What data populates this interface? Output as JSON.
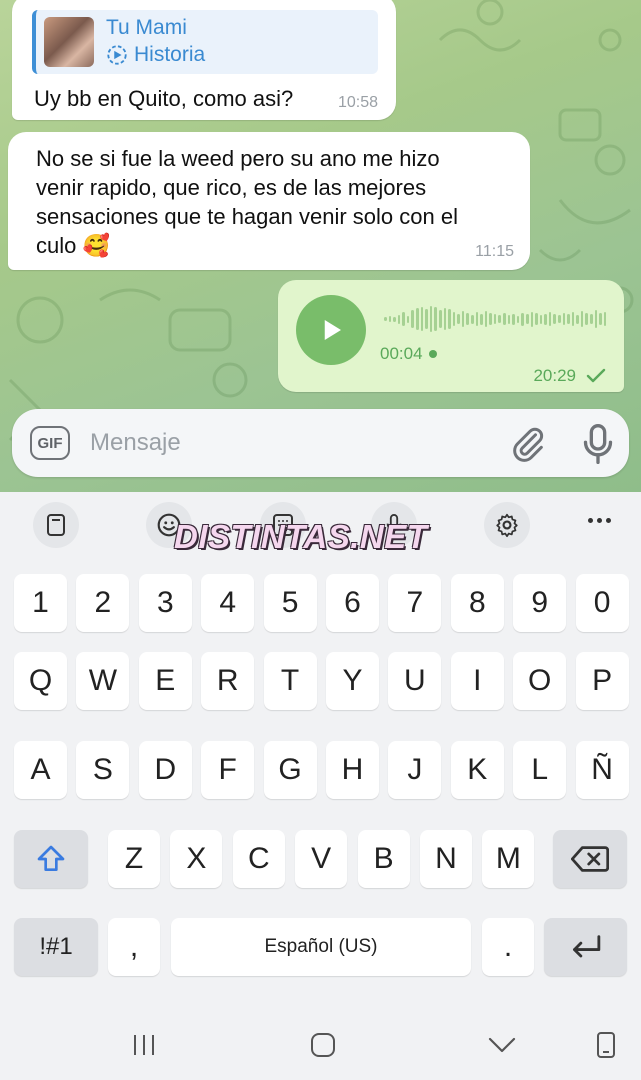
{
  "chat": {
    "messages": [
      {
        "direction": "incoming",
        "reply_to": {
          "name": "Tu Mami",
          "label": "Historia"
        },
        "text": "Uy bb en Quito, como asi?",
        "time": "10:58"
      },
      {
        "direction": "incoming",
        "lines": [
          "No se si fue la weed pero su ano me hizo",
          "venir rapido, que rico, es de las mejores",
          "sensaciones que te hagan venir solo con el",
          "culo 🥰"
        ],
        "time": "11:15"
      },
      {
        "direction": "outgoing",
        "type": "voice",
        "duration": "00:04",
        "time": "20:29",
        "status_icon": "check-icon"
      }
    ]
  },
  "composer": {
    "gif_label": "GIF",
    "placeholder": "Mensaje",
    "attach_icon": "paperclip-icon",
    "mic_icon": "microphone-icon"
  },
  "keyboard": {
    "toolbar_icons": [
      "clipboard-icon",
      "emoji-icon",
      "keyboard-icon",
      "voice-input-icon",
      "settings-icon",
      "more-icon"
    ],
    "watermark": "DISTINTAS.NET",
    "row_numbers": [
      "1",
      "2",
      "3",
      "4",
      "5",
      "6",
      "7",
      "8",
      "9",
      "0"
    ],
    "row_1": [
      "Q",
      "W",
      "E",
      "R",
      "T",
      "Y",
      "U",
      "I",
      "O",
      "P"
    ],
    "row_2": [
      "A",
      "S",
      "D",
      "F",
      "G",
      "H",
      "J",
      "K",
      "L",
      "Ñ"
    ],
    "row_3": [
      "Z",
      "X",
      "C",
      "V",
      "B",
      "N",
      "M"
    ],
    "symbols_label": "!#1",
    "comma": ",",
    "space_label": "Español (US)",
    "period": "."
  },
  "navbar": {
    "icons": [
      "recent-apps-icon",
      "home-icon",
      "back-icon",
      "keyboard-switch-icon"
    ]
  },
  "colors": {
    "chat_bg": "#a6c98a",
    "outgoing_bubble": "#e1f5cc",
    "accent_green": "#79bd6a",
    "reply_blue": "#3a8ad1"
  }
}
